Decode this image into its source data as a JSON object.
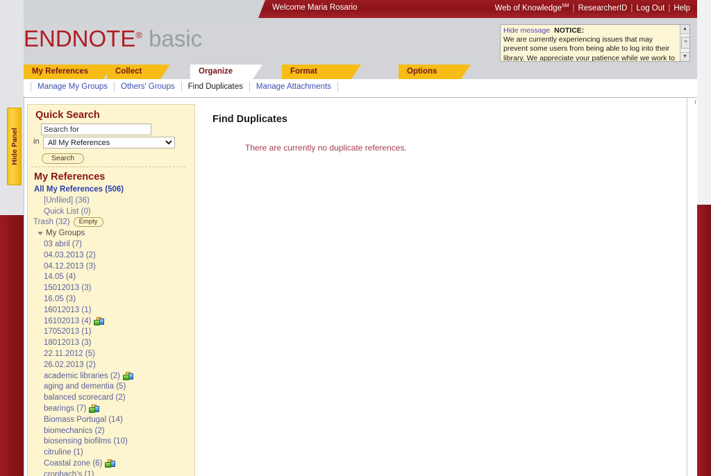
{
  "topbar": {
    "welcome": "Welcome Maria Rosario",
    "links": [
      {
        "label": "Web of Knowledge",
        "sup": "SM"
      },
      {
        "label": "ResearcherID"
      },
      {
        "label": "Log Out"
      },
      {
        "label": "Help"
      }
    ],
    "separator": "|"
  },
  "branding": {
    "name": "ENDNOTE",
    "registered": "®",
    "edition": "basic"
  },
  "notice": {
    "hide_label": "Hide message",
    "title": "NOTICE:",
    "body": "We are currently experiencing issues that may prevent some users from being able to log into their library. We appreciate your patience while we work to",
    "scroll_up": "▲",
    "scroll_down": "▼",
    "thumb": "≡"
  },
  "tabs": [
    {
      "label": "My References",
      "active": false
    },
    {
      "label": "Collect",
      "active": false
    },
    {
      "label": "Organize",
      "active": true
    },
    {
      "label": "Format",
      "active": false
    },
    {
      "label": "Options",
      "active": false
    }
  ],
  "subnav": [
    {
      "label": "Manage My Groups",
      "current": false
    },
    {
      "label": "Others' Groups",
      "current": false
    },
    {
      "label": "Find Duplicates",
      "current": true
    },
    {
      "label": "Manage Attachments",
      "current": false
    }
  ],
  "hide_panel": {
    "label": "Hide Panel"
  },
  "quick_search": {
    "title": "Quick Search",
    "input_value": "Search for",
    "input_placeholder": "Search for",
    "in_label": "in",
    "scope_selected": "All My References",
    "scope_options": [
      "All My References"
    ],
    "button_label": "Search"
  },
  "my_references": {
    "title": "My References",
    "all_label": "All My References (506)",
    "unfiled_label": "[Unfiled] (36)",
    "quick_list_label": "Quick List (0)",
    "trash_label": "Trash (32)",
    "trash_empty_button": "Empty",
    "my_groups_label": "My Groups",
    "groups": [
      {
        "label": "03 abril (7)",
        "shared": false
      },
      {
        "label": "04.03.2013 (2)",
        "shared": false
      },
      {
        "label": "04.12.2013 (3)",
        "shared": false
      },
      {
        "label": "14.05 (4)",
        "shared": false
      },
      {
        "label": "15012013 (3)",
        "shared": false
      },
      {
        "label": "16.05 (3)",
        "shared": false
      },
      {
        "label": "16012013 (1)",
        "shared": false
      },
      {
        "label": "16102013 (4)",
        "shared": true
      },
      {
        "label": "17052013 (1)",
        "shared": false
      },
      {
        "label": "18012013 (3)",
        "shared": false
      },
      {
        "label": "22.11.2012 (5)",
        "shared": false
      },
      {
        "label": "26.02.2013 (2)",
        "shared": false
      },
      {
        "label": "academic libraries (2)",
        "shared": true
      },
      {
        "label": "aging and dementia (5)",
        "shared": false
      },
      {
        "label": "balanced scorecard (2)",
        "shared": false
      },
      {
        "label": "bearings (7)",
        "shared": true
      },
      {
        "label": "Biomass Portugal (14)",
        "shared": false
      },
      {
        "label": "biomechanics (2)",
        "shared": false
      },
      {
        "label": "biosensing biofilms (10)",
        "shared": false
      },
      {
        "label": "citruline (1)",
        "shared": false
      },
      {
        "label": "Coastal zone (6)",
        "shared": true
      },
      {
        "label": "cronbach's (1)",
        "shared": false
      }
    ]
  },
  "main": {
    "title": "Find Duplicates",
    "message": "There are currently no duplicate references."
  },
  "colors": {
    "brand_red": "#8c1318",
    "tab_gold": "#f6bd16",
    "sidebar_cream": "#fcf5cf",
    "link_blue": "#3b4faf",
    "message_red": "#a83a52"
  }
}
